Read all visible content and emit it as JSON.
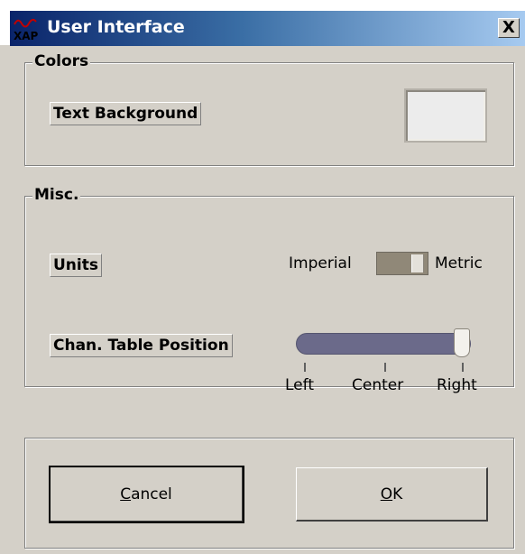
{
  "window": {
    "title": "User Interface",
    "close_glyph": "X",
    "icon_text": "XAP",
    "icon_name": "xap-app-icon"
  },
  "colors_group": {
    "legend": "Colors",
    "text_background_label": "Text Background",
    "swatch_color": "#ececec"
  },
  "misc_group": {
    "legend": "Misc.",
    "units_label": "Units",
    "units_left": "Imperial",
    "units_right": "Metric",
    "units_selected": "Metric",
    "chan_table_label": "Chan. Table Position",
    "position_ticks": [
      "Left",
      "Center",
      "Right"
    ],
    "position_value": "Right"
  },
  "buttons": {
    "cancel_label": "Cancel",
    "cancel_mnemonic": "C",
    "ok_label": "OK",
    "ok_mnemonic": "O"
  },
  "colors": {
    "caption_start": "#0a246a",
    "caption_end": "#a6caf0",
    "face": "#d4d0c8",
    "slider_track": "#6b6a8a"
  }
}
